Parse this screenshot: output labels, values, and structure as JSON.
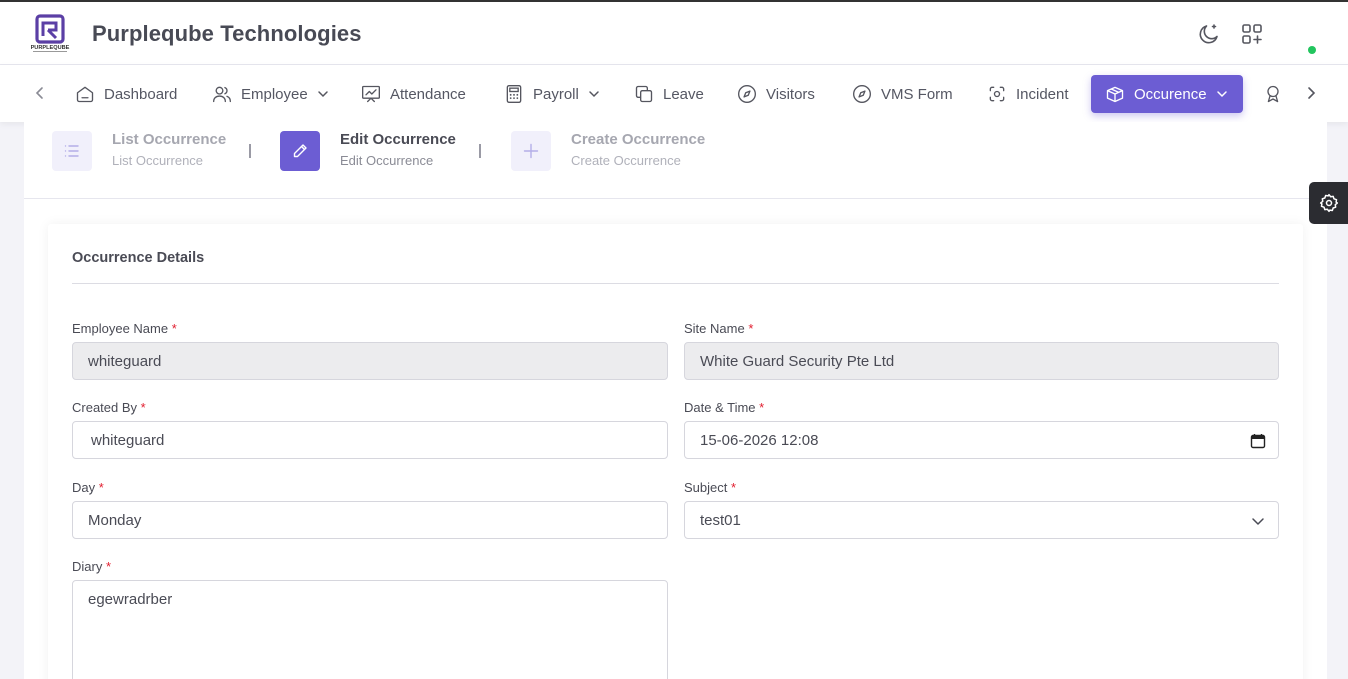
{
  "app": {
    "brand_name": "Purpleqube Technologies",
    "logo_text": "PURPLEQUBE",
    "accent_color": "#6c5dd3",
    "online_status_color": "#22c55e"
  },
  "topbar": {
    "icons": [
      "theme-toggle-moon-icon",
      "apps-grid-icon"
    ]
  },
  "nav": {
    "items": [
      {
        "label": "Dashboard",
        "icon": "home-icon",
        "dropdown": false
      },
      {
        "label": "Employee",
        "icon": "users-icon",
        "dropdown": true
      },
      {
        "label": "Attendance",
        "icon": "presentation-chart-icon",
        "dropdown": false
      },
      {
        "label": "Payroll",
        "icon": "calculator-icon",
        "dropdown": true
      },
      {
        "label": "Leave",
        "icon": "copy-icon",
        "dropdown": false
      },
      {
        "label": "Visitors",
        "icon": "compass-icon",
        "dropdown": false
      },
      {
        "label": "VMS Form",
        "icon": "compass-icon",
        "dropdown": false
      },
      {
        "label": "Incident",
        "icon": "focus-icon",
        "dropdown": false
      },
      {
        "label": "Occurence",
        "icon": "box-icon",
        "dropdown": true,
        "active": true
      }
    ]
  },
  "steps": [
    {
      "title": "List Occurrence",
      "subtitle": "List Occurrence",
      "icon": "list-icon",
      "active": false
    },
    {
      "title": "Edit Occurrence",
      "subtitle": "Edit Occurrence",
      "icon": "pencil-icon",
      "active": true
    },
    {
      "title": "Create Occurrence",
      "subtitle": "Create Occurrence",
      "icon": "plus-icon",
      "active": false
    }
  ],
  "form": {
    "title": "Occurrence Details",
    "required_marker": "*",
    "employee_name": {
      "label": "Employee Name",
      "value": "whiteguard",
      "disabled": true
    },
    "site_name": {
      "label": "Site Name",
      "value": "White Guard Security Pte Ltd",
      "disabled": true
    },
    "created_by": {
      "label": "Created By",
      "value": "whiteguard"
    },
    "date_time": {
      "label": "Date & Time",
      "value": "15-06-2026 12:08"
    },
    "day": {
      "label": "Day",
      "value": "Monday"
    },
    "subject": {
      "label": "Subject",
      "value": "test01"
    },
    "diary": {
      "label": "Diary",
      "value": "egewradrber"
    }
  }
}
